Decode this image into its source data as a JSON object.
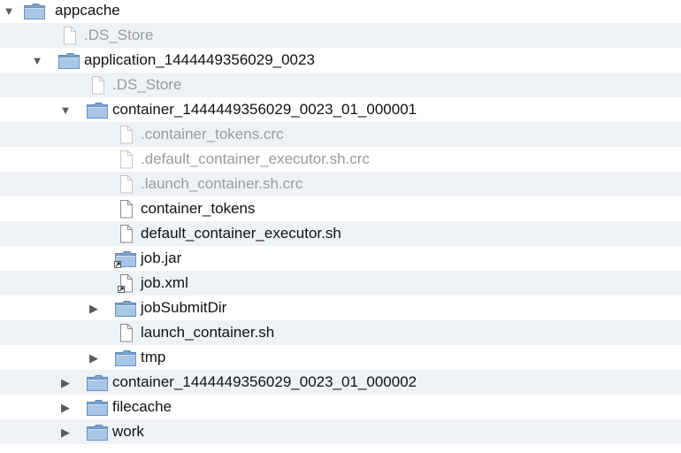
{
  "tree": {
    "rows": [
      {
        "label": "appcache",
        "kind": "folder",
        "depth": 0,
        "toggle": "open",
        "dim": false
      },
      {
        "label": ".DS_Store",
        "kind": "file",
        "depth": 1,
        "toggle": "none",
        "dim": true
      },
      {
        "label": "application_1444449356029_0023",
        "kind": "folder",
        "depth": 1,
        "toggle": "open",
        "dim": false
      },
      {
        "label": ".DS_Store",
        "kind": "file",
        "depth": 2,
        "toggle": "none",
        "dim": true
      },
      {
        "label": "container_1444449356029_0023_01_000001",
        "kind": "folder",
        "depth": 2,
        "toggle": "open",
        "dim": false
      },
      {
        "label": ".container_tokens.crc",
        "kind": "file",
        "depth": 3,
        "toggle": "none",
        "dim": true
      },
      {
        "label": ".default_container_executor.sh.crc",
        "kind": "file",
        "depth": 3,
        "toggle": "none",
        "dim": true
      },
      {
        "label": ".launch_container.sh.crc",
        "kind": "file",
        "depth": 3,
        "toggle": "none",
        "dim": true
      },
      {
        "label": "container_tokens",
        "kind": "file",
        "depth": 3,
        "toggle": "none",
        "dim": false
      },
      {
        "label": "default_container_executor.sh",
        "kind": "file",
        "depth": 3,
        "toggle": "none",
        "dim": false
      },
      {
        "label": "job.jar",
        "kind": "folder-alias",
        "depth": 3,
        "toggle": "none",
        "dim": false
      },
      {
        "label": "job.xml",
        "kind": "file-alias",
        "depth": 3,
        "toggle": "none",
        "dim": false
      },
      {
        "label": "jobSubmitDir",
        "kind": "folder",
        "depth": 3,
        "toggle": "closed",
        "dim": false
      },
      {
        "label": "launch_container.sh",
        "kind": "file",
        "depth": 3,
        "toggle": "none",
        "dim": false
      },
      {
        "label": "tmp",
        "kind": "folder",
        "depth": 3,
        "toggle": "closed",
        "dim": false
      },
      {
        "label": "container_1444449356029_0023_01_000002",
        "kind": "folder",
        "depth": 2,
        "toggle": "closed",
        "dim": false
      },
      {
        "label": "filecache",
        "kind": "folder",
        "depth": 2,
        "toggle": "closed",
        "dim": false
      },
      {
        "label": "work",
        "kind": "folder",
        "depth": 2,
        "toggle": "closed",
        "dim": false
      }
    ]
  },
  "colors": {
    "stripe": "#eef2f7",
    "folder": "#8fb3d6",
    "dim_text": "#9a9a9a",
    "text": "#111111"
  }
}
